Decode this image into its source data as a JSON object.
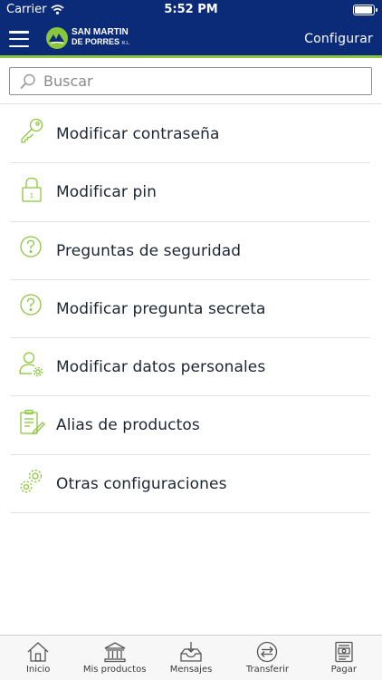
{
  "status_bar": {
    "carrier": "Carrier",
    "time": "5:52 PM"
  },
  "header": {
    "logo": {
      "line1": "SAN MARTIN",
      "line2": "DE PORRES",
      "suffix": "R.L."
    },
    "config_label": "Configurar"
  },
  "search": {
    "placeholder": "Buscar",
    "value": ""
  },
  "menu": {
    "items": [
      {
        "label": "Modificar contraseña",
        "icon": "key-icon"
      },
      {
        "label": "Modificar pin",
        "icon": "lock-icon"
      },
      {
        "label": "Preguntas de seguridad",
        "icon": "question-circle-icon"
      },
      {
        "label": "Modificar pregunta secreta",
        "icon": "question-circle-icon"
      },
      {
        "label": "Modificar datos personales",
        "icon": "user-settings-icon"
      },
      {
        "label": "Alias de productos",
        "icon": "clipboard-edit-icon"
      },
      {
        "label": "Otras configuraciones",
        "icon": "gears-icon"
      }
    ]
  },
  "tabbar": {
    "tabs": [
      {
        "label": "Inicio",
        "icon": "home-icon"
      },
      {
        "label": "Mis productos",
        "icon": "bank-icon"
      },
      {
        "label": "Mensajes",
        "icon": "inbox-download-icon"
      },
      {
        "label": "Transferir",
        "icon": "transfer-icon"
      },
      {
        "label": "Pagar",
        "icon": "bill-payment-icon"
      }
    ]
  },
  "colors": {
    "primary": "#0b2a78",
    "accent": "#8cc63f",
    "text": "#1d2533"
  }
}
